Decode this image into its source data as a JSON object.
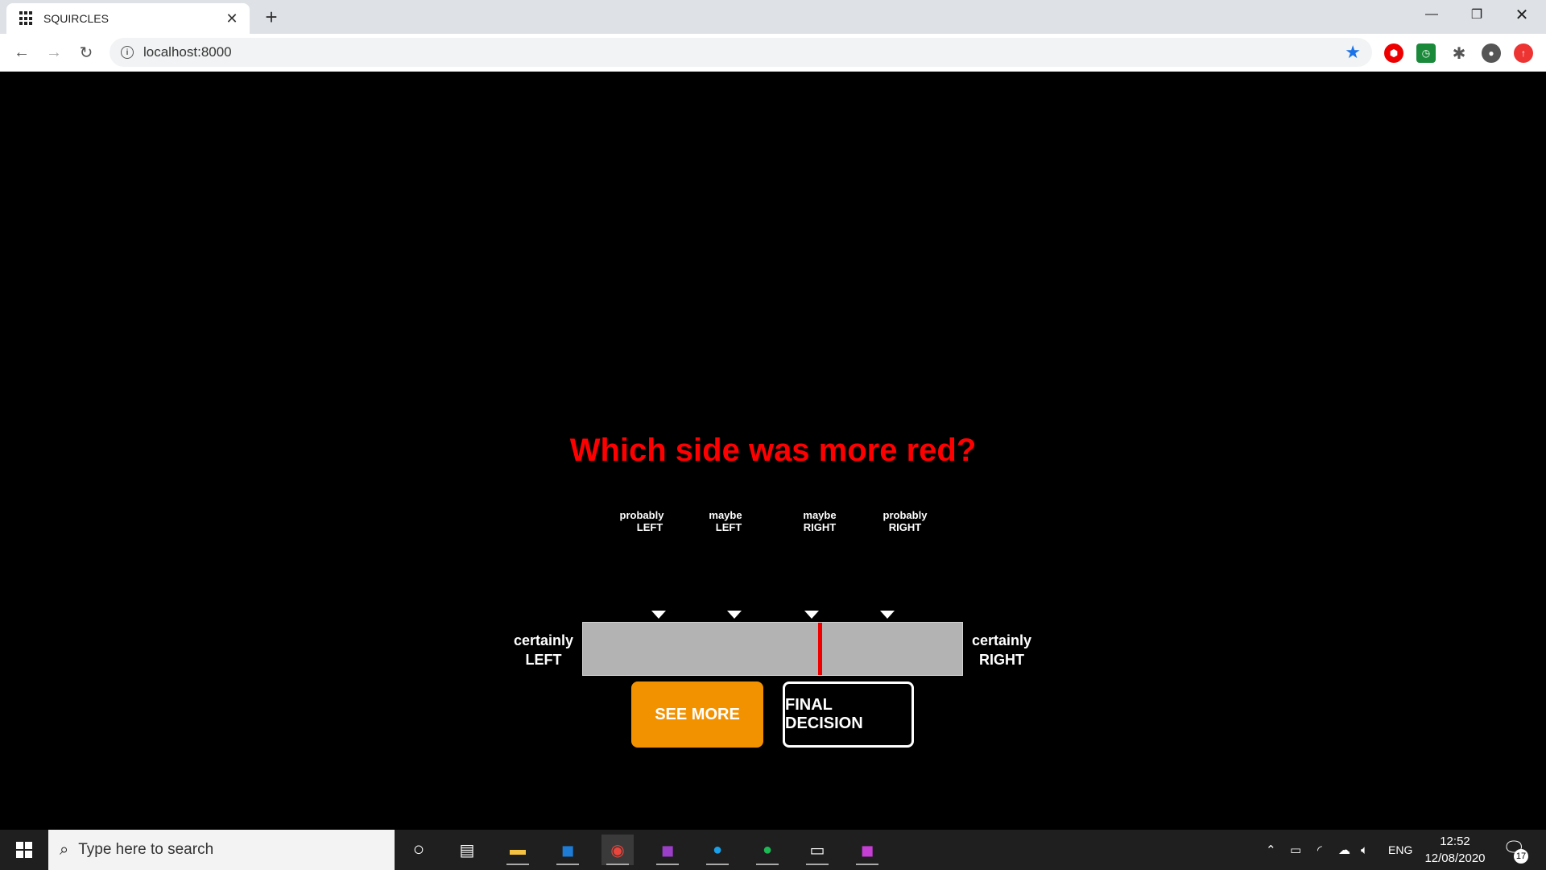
{
  "browser": {
    "tab_title": "SQUIRCLES",
    "url": "localhost:8000"
  },
  "task": {
    "question": "Which side was more red?",
    "question_color": "#ff0000",
    "ticks": [
      {
        "top": "probably",
        "bottom": "LEFT"
      },
      {
        "top": "maybe",
        "bottom": "LEFT"
      },
      {
        "top": "maybe",
        "bottom": "RIGHT"
      },
      {
        "top": "probably",
        "bottom": "RIGHT"
      }
    ],
    "left_end": {
      "top": "certainly",
      "bottom": "LEFT"
    },
    "right_end": {
      "top": "certainly",
      "bottom": "RIGHT"
    },
    "slider_value": 0.625,
    "see_more_label": "SEE MORE",
    "final_decision_label": "FINAL DECISION",
    "see_more_color": "#f39200"
  },
  "taskbar": {
    "search_placeholder": "Type here to search",
    "time": "12:52",
    "date": "12/08/2020",
    "language": "ENG",
    "notification_count": "17"
  }
}
